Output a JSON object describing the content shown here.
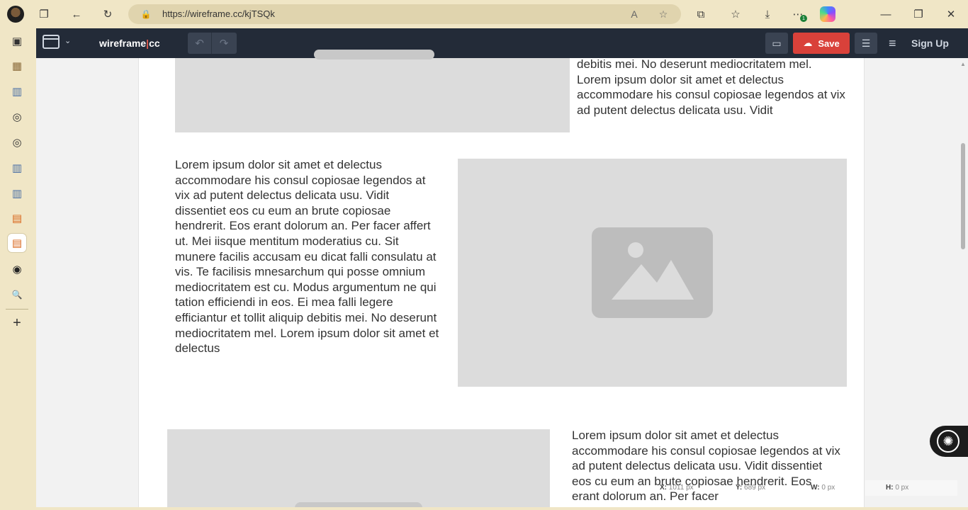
{
  "browser": {
    "url": "https://wireframe.cc/kjTSQk",
    "download_badge": "1"
  },
  "app": {
    "brand_left": "wireframe",
    "brand_sep": "|",
    "brand_right": "cc",
    "save_label": "Save",
    "signup_label": "Sign Up"
  },
  "content": {
    "text_top": "debitis mei. No deserunt mediocritatem mel. Lorem ipsum dolor sit amet et delectus accommodare his consul copiosae legendos at vix ad putent delectus delicata usu. Vidit",
    "text_middle": "Lorem ipsum dolor sit amet et delectus accommodare his consul copiosae legendos at vix ad putent delectus delicata usu. Vidit dissentiet eos cu eum an brute copiosae hendrerit. Eos erant dolorum an. Per facer affert ut. Mei iisque mentitum moderatius cu. Sit munere facilis accusam eu dicat falli consulatu at vis. Te facilisis mnesarchum qui posse omnium mediocritatem est cu. Modus argumentum ne qui tation efficiendi in eos. Ei mea falli legere efficiantur et tollit aliquip debitis mei. No deserunt mediocritatem mel. Lorem ipsum dolor sit amet et delectus",
    "text_bottom": "Lorem ipsum dolor sit amet et delectus accommodare his consul copiosae legendos at vix ad putent delectus delicata usu. Vidit dissentiet eos cu eum an brute copiosae hendrerit. Eos erant dolorum an. Per facer"
  },
  "status": {
    "x_label": "X:",
    "x_value": "1011 px",
    "y_label": "Y:",
    "y_value": "689 px",
    "w_label": "W:",
    "w_value": "0 px",
    "h_label": "H:",
    "h_value": "0 px"
  },
  "icons": {
    "sidebar": [
      "tabs-icon",
      "calendar-icon",
      "chart-icon",
      "globe-icon",
      "globe-icon",
      "chart-icon",
      "chart-icon",
      "browser-window-icon",
      "browser-window-icon",
      "globe-icon",
      "search-icon",
      "add-icon"
    ]
  }
}
